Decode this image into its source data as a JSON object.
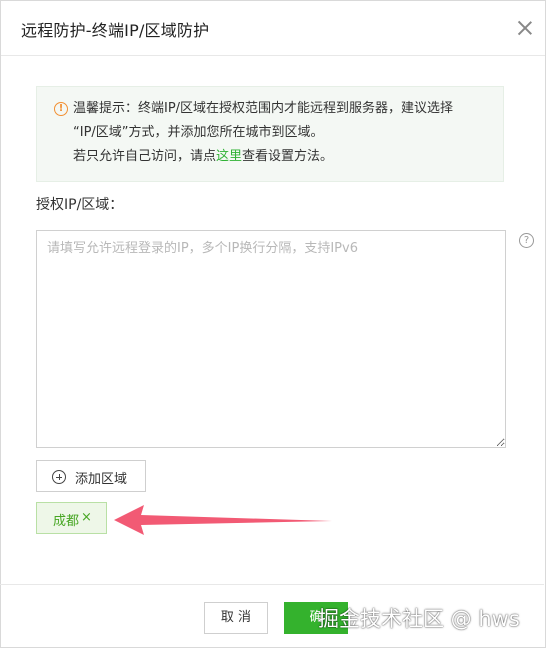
{
  "dialog": {
    "title": "远程防护-终端IP/区域防护"
  },
  "tip": {
    "icon": "info-icon",
    "line1": "温馨提示：终端IP/区域在授权范围内才能远程到服务器，建议选择",
    "line2": "“IP/区域”方式，并添加您所在城市到区域。",
    "line3_prefix": "若只允许自己访问，请点",
    "line3_link": "这里",
    "line3_suffix": "查看设置方法。"
  },
  "form": {
    "field_label": "授权IP/区域：",
    "textarea_value": "",
    "textarea_placeholder": "请填写允许远程登录的IP，多个IP换行分隔，支持IPv6",
    "help_icon": "question-icon",
    "add_button_label": "添加区域",
    "tags": [
      {
        "label": "成都",
        "close": "×"
      }
    ]
  },
  "footer": {
    "cancel_label": "取 消",
    "ok_label": "确"
  },
  "watermark": "掘金技术社区 @ hws",
  "colors": {
    "accent": "#34b22d",
    "link": "#2fb235",
    "warning": "#f29033",
    "arrow": "#f25a74"
  }
}
